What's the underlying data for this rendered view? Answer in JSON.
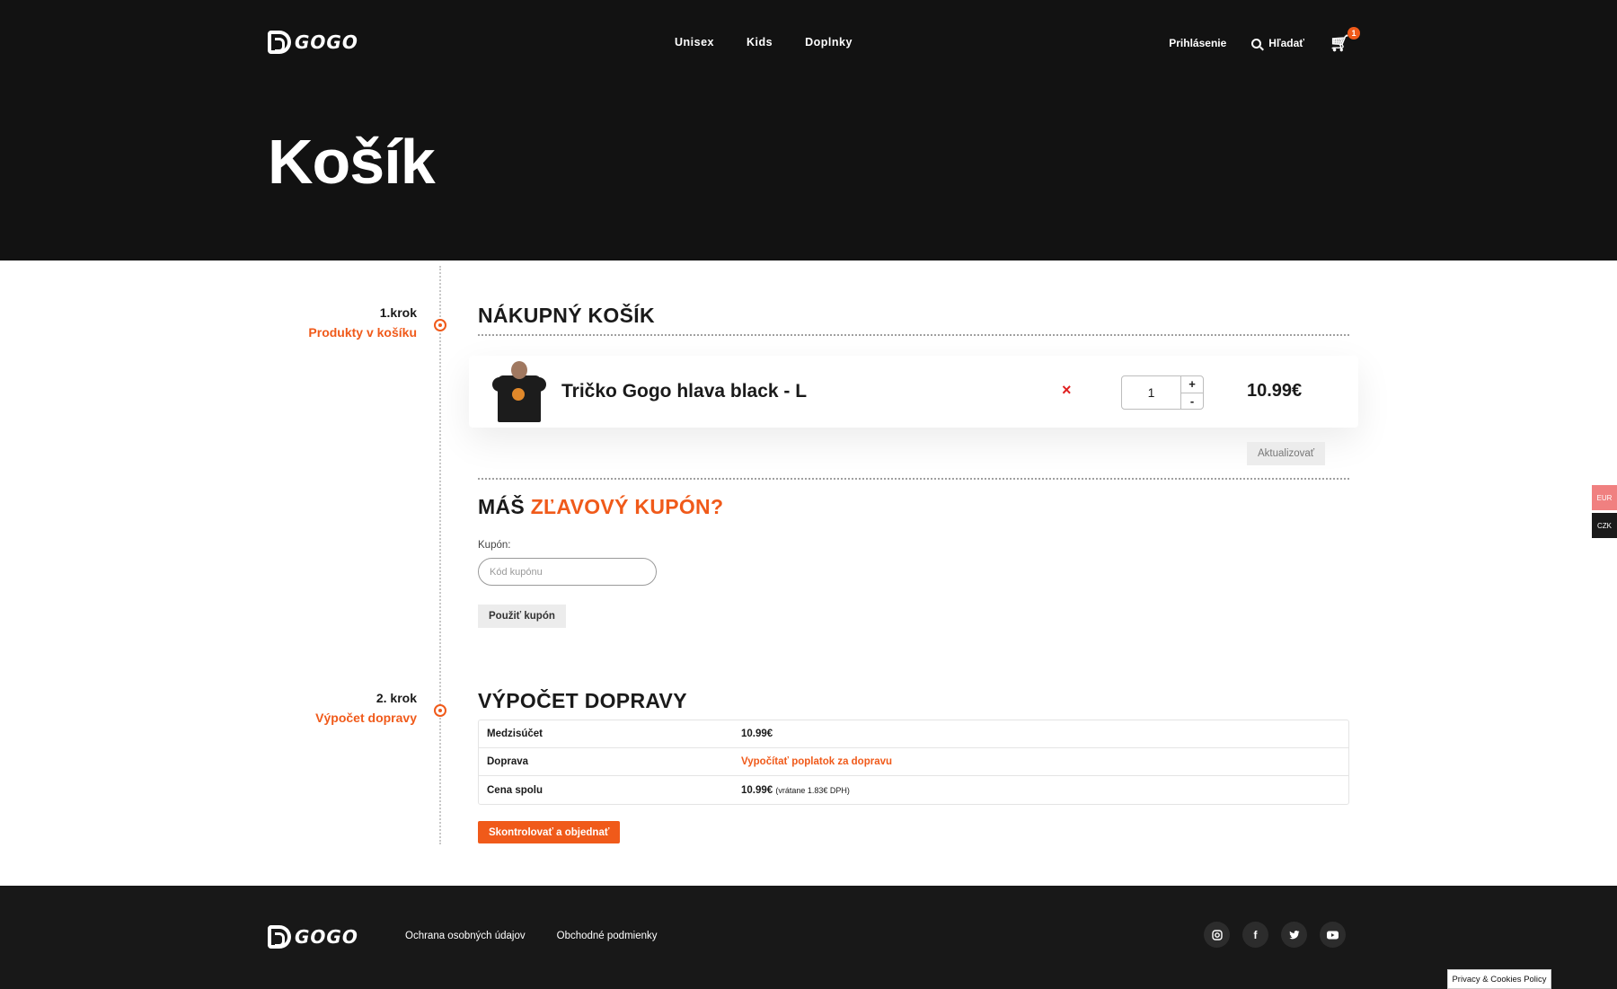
{
  "brand": {
    "logo_text": "GOGO"
  },
  "nav": {
    "items": [
      "Unisex",
      "Kids",
      "Doplnky"
    ]
  },
  "topbar": {
    "login": "Prihlásenie",
    "search": "Hľadať",
    "cart_count": "1"
  },
  "page": {
    "title": "Košík"
  },
  "steps": [
    {
      "num": "1.krok",
      "label": "Produkty v košíku"
    },
    {
      "num": "2. krok",
      "label": "Výpočet dopravy"
    }
  ],
  "cart": {
    "title": "NÁKUPNÝ KOŠÍK",
    "item": {
      "name": "Tričko Gogo hlava black - L",
      "remove": "×",
      "qty": "1",
      "plus": "+",
      "minus": "-",
      "price": "10.99€"
    },
    "update_label": "Aktualizovať"
  },
  "coupon": {
    "title_prefix": "MÁŠ ",
    "title_accent": "ZĽAVOVÝ KUPÓN?",
    "label": "Kupón:",
    "placeholder": "Kód kupónu",
    "button": "Použiť kupón"
  },
  "shipping": {
    "title": "VÝPOČET DOPRAVY",
    "rows": [
      {
        "label": "Medzisúčet",
        "value": "10.99€"
      },
      {
        "label": "Doprava",
        "value": "Vypočítať poplatok za dopravu"
      },
      {
        "label": "Cena spolu",
        "value": "10.99€",
        "note": "(vrátane 1.83€ DPH)"
      }
    ],
    "order_button": "Skontrolovať a objednať"
  },
  "currency": {
    "eur": "EUR",
    "czk": "CZK"
  },
  "footer": {
    "links": [
      "Ochrana osobných údajov",
      "Obchodné podmienky"
    ],
    "socials": [
      "instagram-icon",
      "facebook-icon",
      "twitter-icon",
      "youtube-icon"
    ]
  },
  "privacy": {
    "label": "Privacy & Cookies Policy"
  },
  "colors": {
    "accent": "#f05a1a",
    "dark": "#121212"
  }
}
